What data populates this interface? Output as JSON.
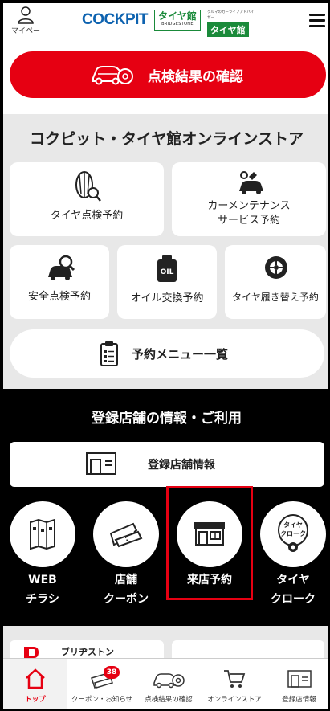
{
  "header": {
    "mypage_label": "マイページ",
    "logo_cockpit": "COCKPIT",
    "logo_tire_main": "タイヤ館",
    "logo_tire_sub": "BRIDGESTONE",
    "logo_tire2_tagline": "クルマのカーライフアドバイザー",
    "logo_tire2_main": "タイヤ館"
  },
  "result_button": {
    "label": "点検結果の確認"
  },
  "online_store": {
    "title": "コクピット・タイヤ館オンラインストア",
    "cards": [
      {
        "label": "タイヤ点検予約"
      },
      {
        "label_line1": "カーメンテナンス",
        "label_line2": "サービス予約"
      },
      {
        "label": "安全点検予約"
      },
      {
        "label": "オイル交換予約",
        "icon_text": "OIL"
      },
      {
        "label": "タイヤ履き替え予約"
      }
    ],
    "menu_list_label": "予約メニュー一覧"
  },
  "registered_store": {
    "title": "登録店舗の情報・ご利用",
    "info_button_label": "登録店舗情報",
    "circles": [
      {
        "line1": "WEB",
        "line2": "チラシ"
      },
      {
        "line1": "店舗",
        "line2": "クーポン"
      },
      {
        "line1": "来店予約",
        "line2": ""
      },
      {
        "line1": "タイヤ",
        "line2": "クローク",
        "icon_text1": "タイヤ",
        "icon_text2": "クローク"
      }
    ]
  },
  "banner": {
    "text": "ブリヂストン"
  },
  "bottom_nav": {
    "items": [
      {
        "label": "トップ"
      },
      {
        "label": "クーポン・お知らせ",
        "badge": "38"
      },
      {
        "label": "点検結果の確認"
      },
      {
        "label": "オンラインストア"
      },
      {
        "label": "登録店情報"
      }
    ]
  },
  "colors": {
    "accent_red": "#e60012",
    "brand_blue": "#0e63b0",
    "brand_green": "#1a8a3a"
  }
}
